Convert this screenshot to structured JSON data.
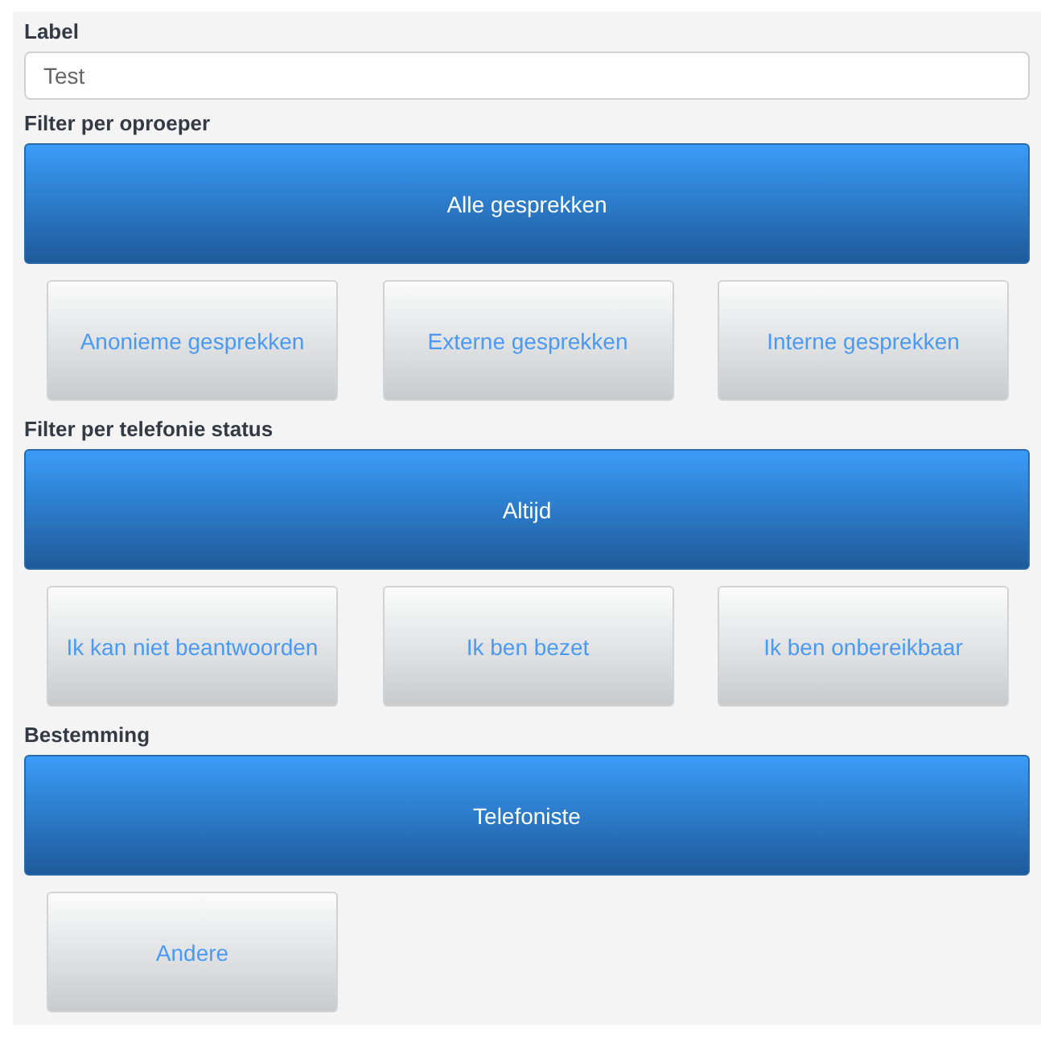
{
  "label_field": {
    "label": "Label",
    "value": "Test"
  },
  "sections": [
    {
      "title": "Filter per oproeper",
      "options": [
        {
          "label": "Alle gesprekken",
          "selected": true
        },
        {
          "label": "Anonieme gesprekken",
          "selected": false
        },
        {
          "label": "Externe gesprekken",
          "selected": false
        },
        {
          "label": "Interne gesprekken",
          "selected": false
        }
      ]
    },
    {
      "title": "Filter per telefonie status",
      "options": [
        {
          "label": "Altijd",
          "selected": true
        },
        {
          "label": "Ik kan niet beantwoorden",
          "selected": false
        },
        {
          "label": "Ik ben bezet",
          "selected": false
        },
        {
          "label": "Ik ben onbereikbaar",
          "selected": false
        }
      ]
    },
    {
      "title": "Bestemming",
      "options": [
        {
          "label": "Telefoniste",
          "selected": true
        },
        {
          "label": "Andere",
          "selected": false
        }
      ]
    }
  ]
}
